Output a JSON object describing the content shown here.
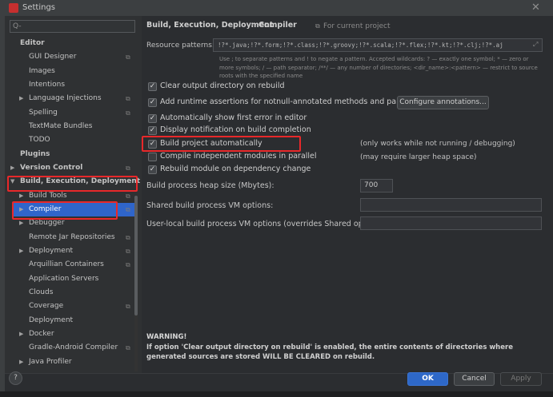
{
  "window": {
    "title": "Settings",
    "close_glyph": "✕"
  },
  "search": {
    "placeholder": "Q-"
  },
  "sidebar": {
    "items": [
      {
        "label": "Editor",
        "level": 0,
        "bold": true,
        "arrow": "",
        "copy": false
      },
      {
        "label": "GUI Designer",
        "level": 1,
        "bold": false,
        "arrow": "",
        "copy": true
      },
      {
        "label": "Images",
        "level": 1,
        "bold": false,
        "arrow": "",
        "copy": false
      },
      {
        "label": "Intentions",
        "level": 1,
        "bold": false,
        "arrow": "",
        "copy": false
      },
      {
        "label": "Language Injections",
        "level": 1,
        "bold": false,
        "arrow": "▶",
        "copy": true
      },
      {
        "label": "Spelling",
        "level": 1,
        "bold": false,
        "arrow": "",
        "copy": true
      },
      {
        "label": "TextMate Bundles",
        "level": 1,
        "bold": false,
        "arrow": "",
        "copy": false
      },
      {
        "label": "TODO",
        "level": 1,
        "bold": false,
        "arrow": "",
        "copy": false
      },
      {
        "label": "Plugins",
        "level": 0,
        "bold": true,
        "arrow": "",
        "copy": false
      },
      {
        "label": "Version Control",
        "level": 0,
        "bold": true,
        "arrow": "▶",
        "copy": true
      },
      {
        "label": "Build, Execution, Deployment",
        "level": 0,
        "bold": true,
        "arrow": "▼",
        "copy": false
      },
      {
        "label": "Build Tools",
        "level": 1,
        "bold": false,
        "arrow": "▶",
        "copy": true
      },
      {
        "label": "Compiler",
        "level": 1,
        "bold": false,
        "arrow": "▶",
        "copy": true,
        "selected": true
      },
      {
        "label": "Debugger",
        "level": 1,
        "bold": false,
        "arrow": "▶",
        "copy": false
      },
      {
        "label": "Remote Jar Repositories",
        "level": 1,
        "bold": false,
        "arrow": "",
        "copy": true
      },
      {
        "label": "Deployment",
        "level": 1,
        "bold": false,
        "arrow": "▶",
        "copy": true
      },
      {
        "label": "Arquillian Containers",
        "level": 1,
        "bold": false,
        "arrow": "",
        "copy": true
      },
      {
        "label": "Application Servers",
        "level": 1,
        "bold": false,
        "arrow": "",
        "copy": false
      },
      {
        "label": "Clouds",
        "level": 1,
        "bold": false,
        "arrow": "",
        "copy": false
      },
      {
        "label": "Coverage",
        "level": 1,
        "bold": false,
        "arrow": "",
        "copy": true
      },
      {
        "label": "Deployment",
        "level": 1,
        "bold": false,
        "arrow": "",
        "copy": false
      },
      {
        "label": "Docker",
        "level": 1,
        "bold": false,
        "arrow": "▶",
        "copy": false
      },
      {
        "label": "Gradle-Android Compiler",
        "level": 1,
        "bold": false,
        "arrow": "",
        "copy": true
      },
      {
        "label": "Java Profiler",
        "level": 1,
        "bold": false,
        "arrow": "▶",
        "copy": false
      }
    ]
  },
  "breadcrumb": {
    "parent": "Build, Execution, Deployment",
    "separator": "›",
    "current": "Compiler",
    "scope_label": "For current project"
  },
  "resource_patterns": {
    "label": "Resource patterns:",
    "value": "!?*.java;!?*.form;!?*.class;!?*.groovy;!?*.scala;!?*.flex;!?*.kt;!?*.clj;!?*.aj",
    "help": "Use ; to separate patterns and ! to negate a pattern. Accepted wildcards: ? — exactly one symbol; * — zero or more symbols; / — path separator; /**/ — any number of directories; <dir_name>:<pattern> — restrict to source roots with the specified name"
  },
  "options": [
    {
      "label": "Clear output directory on rebuild",
      "checked": true
    },
    {
      "label": "Add runtime assertions for notnull-annotated methods and parameters",
      "checked": true
    },
    {
      "label": "Automatically show first error in editor",
      "checked": true
    },
    {
      "label": "Display notification on build completion",
      "checked": true
    },
    {
      "label": "Build project automatically",
      "checked": true
    },
    {
      "label": "Compile independent modules in parallel",
      "checked": false
    },
    {
      "label": "Rebuild module on dependency change",
      "checked": true
    }
  ],
  "configure_button": "Configure annotations...",
  "notes": {
    "build_auto": "(only works while not running / debugging)",
    "parallel": "(may require larger heap space)"
  },
  "fields": {
    "heap_label": "Build process heap size (Mbytes):",
    "heap_value": "700",
    "shared_vm_label": "Shared build process VM options:",
    "shared_vm_value": "",
    "user_vm_label": "User-local build process VM options (overrides Shared options):",
    "user_vm_value": ""
  },
  "warning": {
    "title": "WARNING!",
    "text": "If option 'Clear output directory on rebuild' is enabled, the entire contents of directories where generated sources are stored WILL BE CLEARED on rebuild."
  },
  "buttons": {
    "help": "?",
    "ok": "OK",
    "cancel": "Cancel",
    "apply": "Apply"
  },
  "colors": {
    "selection": "#2f65ca",
    "highlight_box": "#e8282a",
    "ok_button": "#2e68c8"
  }
}
